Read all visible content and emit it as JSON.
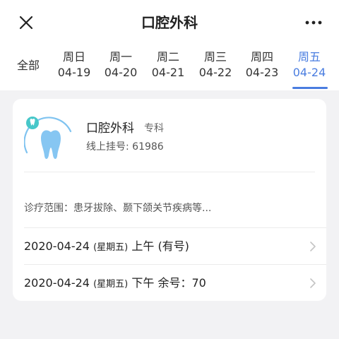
{
  "header": {
    "title": "口腔外科"
  },
  "date_tabs": {
    "all_label": "全部",
    "days": [
      {
        "weekday": "周日",
        "date": "04-19"
      },
      {
        "weekday": "周一",
        "date": "04-20"
      },
      {
        "weekday": "周二",
        "date": "04-21"
      },
      {
        "weekday": "周三",
        "date": "04-22"
      },
      {
        "weekday": "周四",
        "date": "04-23"
      },
      {
        "weekday": "周五",
        "date": "04-24"
      }
    ],
    "active_index": 5
  },
  "department": {
    "name": "口腔外科",
    "tag": "专科",
    "registration": "线上挂号: 61986",
    "scope": "诊疗范围：患牙拔除、颞下颌关节疾病等..."
  },
  "slots": [
    {
      "date": "2020-04-24",
      "weekday": "(星期五)",
      "period": "上午",
      "status": "(有号)"
    },
    {
      "date": "2020-04-24",
      "weekday": "(星期五)",
      "period": "下午",
      "status": "余号：70"
    }
  ],
  "colors": {
    "accent": "#4a7de0",
    "icon_tooth": "#7fc3f0",
    "icon_badge": "#47c7c9"
  },
  "icons": {
    "close": "close-icon",
    "more": "more-icon",
    "tooth": "tooth-icon",
    "chevron": "chevron-right-icon"
  }
}
